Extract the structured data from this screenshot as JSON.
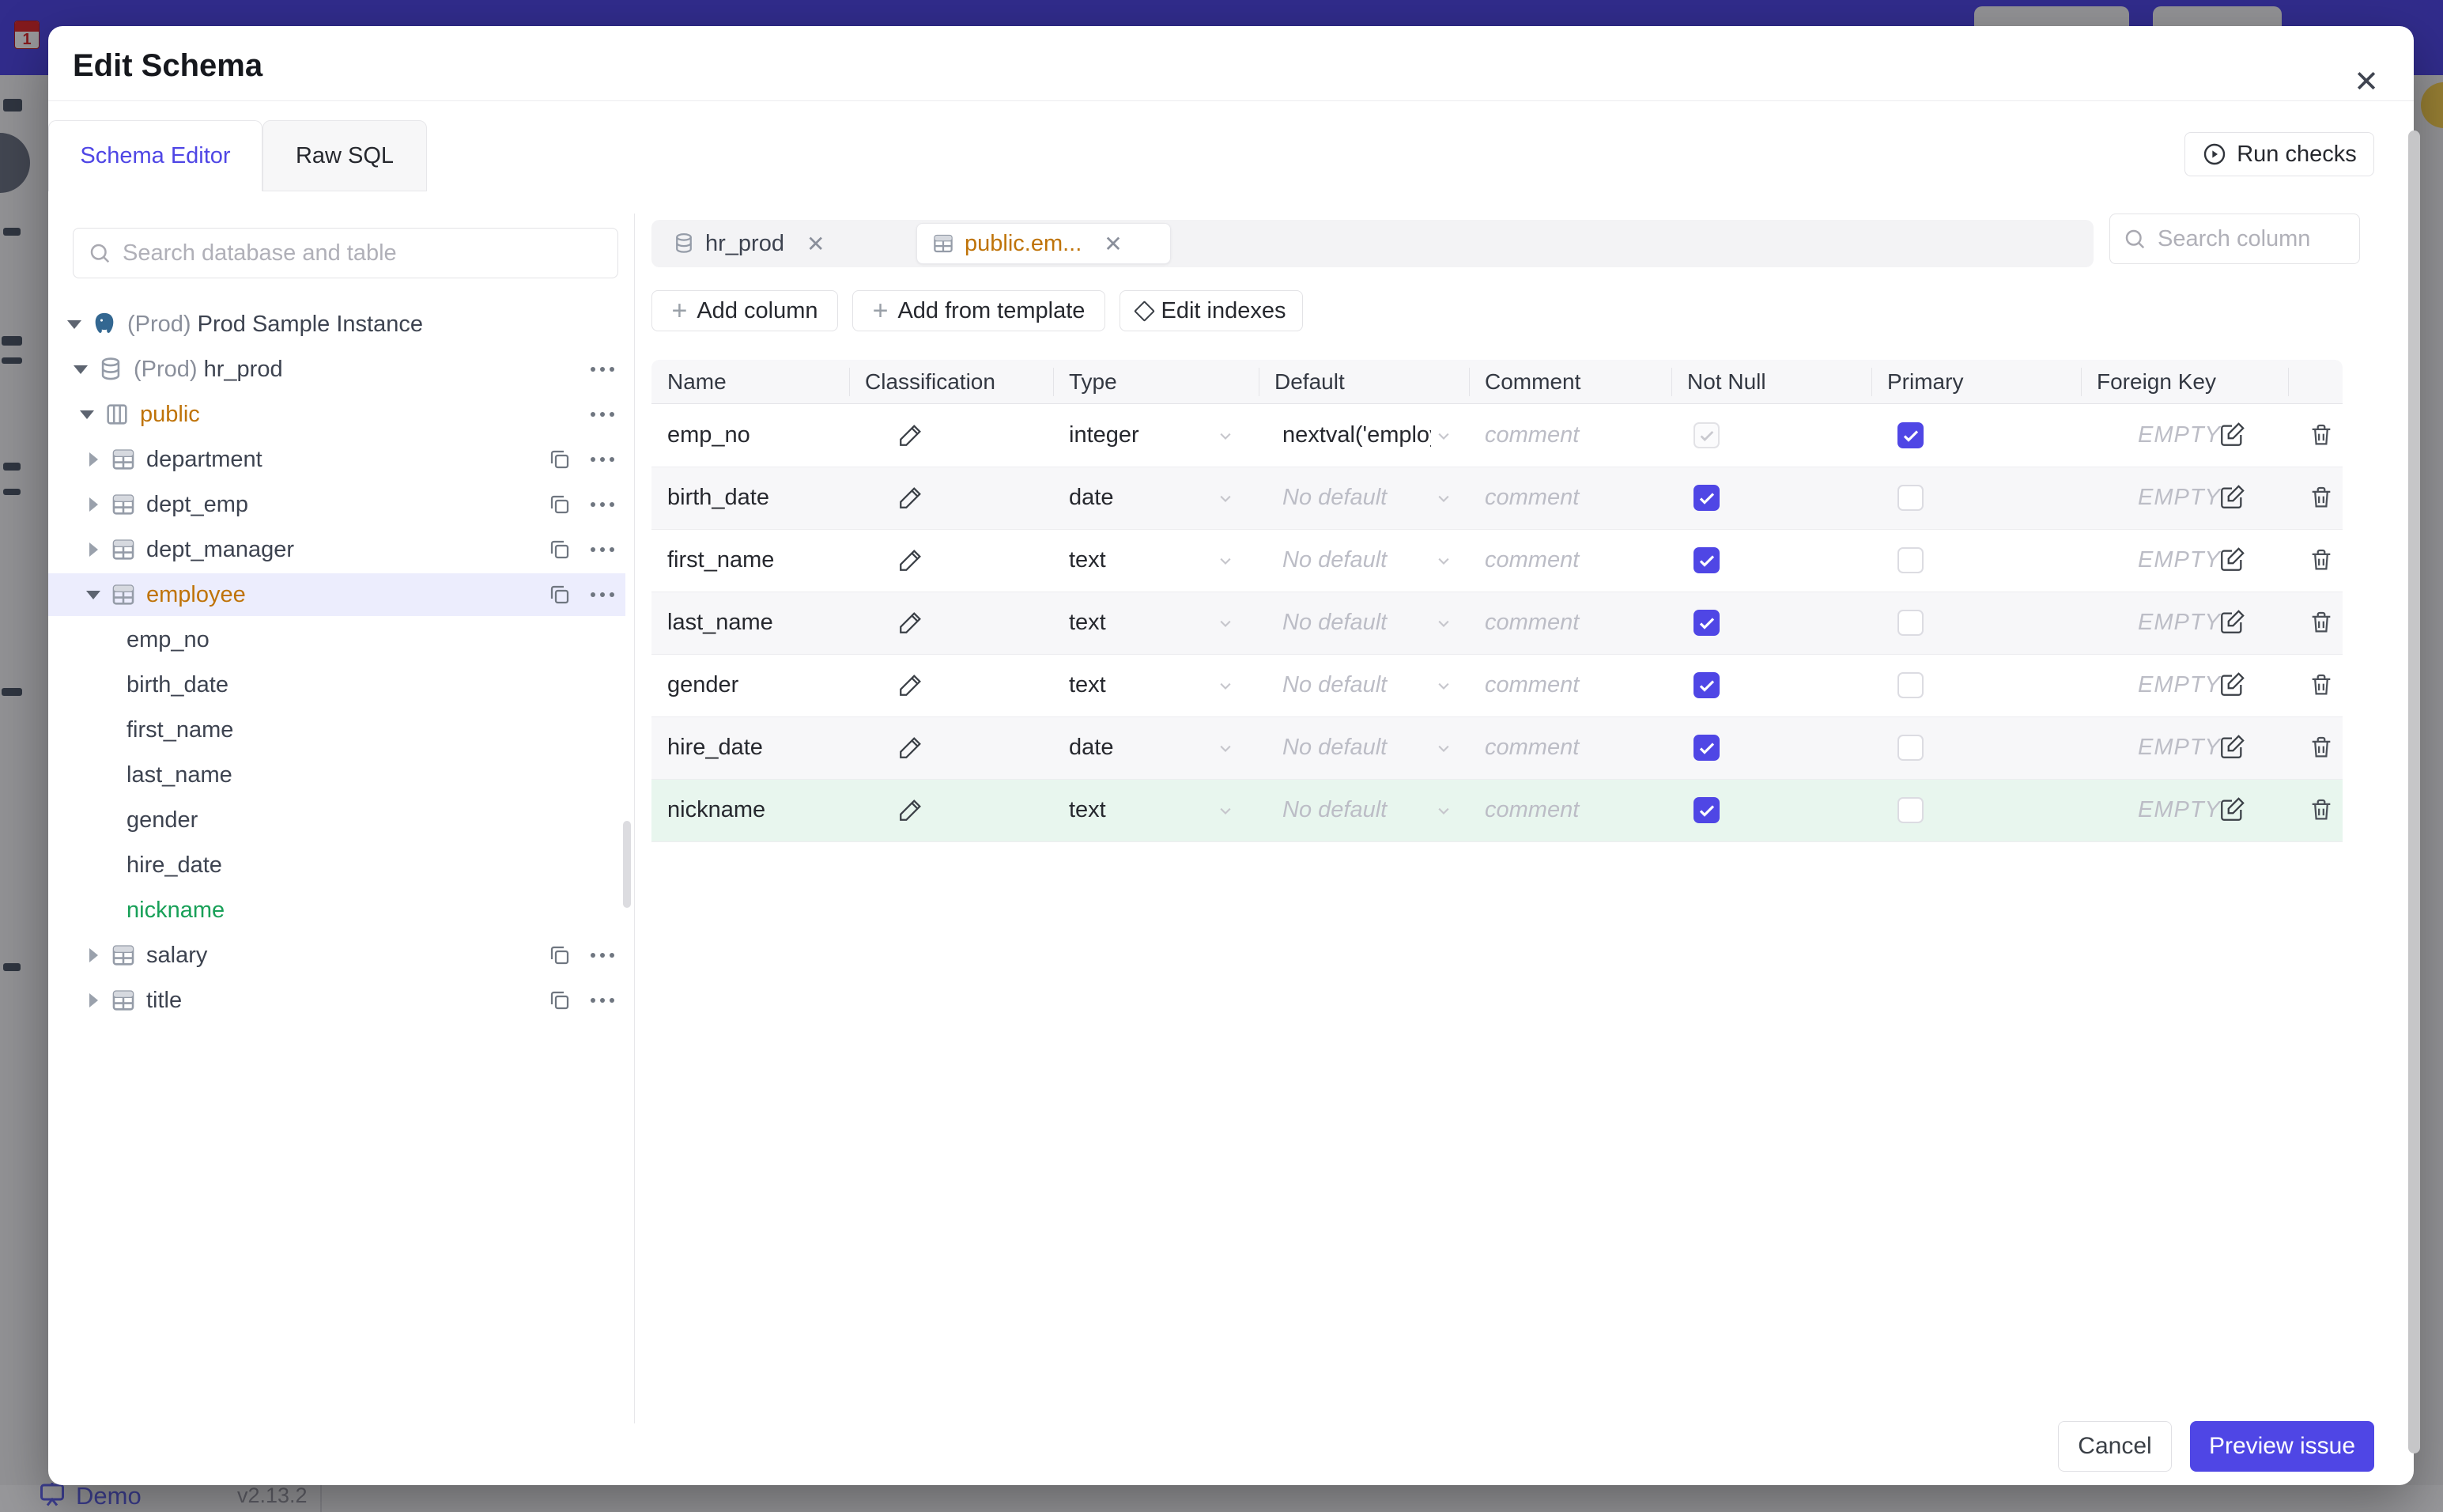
{
  "modal": {
    "title": "Edit Schema",
    "close_icon": "✕"
  },
  "tabs": {
    "schema_editor": "Schema Editor",
    "raw_sql": "Raw SQL"
  },
  "toolbar": {
    "run_checks": "Run checks"
  },
  "sidebar": {
    "search_placeholder": "Search database and table",
    "tree": [
      {
        "type": "instance",
        "prefix": "(Prod) ",
        "label": "Prod Sample Instance"
      },
      {
        "type": "database",
        "prefix": "(Prod) ",
        "label": "hr_prod"
      },
      {
        "type": "schema",
        "label": "public"
      },
      {
        "type": "table",
        "label": "department"
      },
      {
        "type": "table",
        "label": "dept_emp"
      },
      {
        "type": "table",
        "label": "dept_manager"
      },
      {
        "type": "table",
        "label": "employee",
        "state": "selected, expanded, modified"
      },
      {
        "type": "column",
        "label": "emp_no"
      },
      {
        "type": "column",
        "label": "birth_date"
      },
      {
        "type": "column",
        "label": "first_name"
      },
      {
        "type": "column",
        "label": "last_name"
      },
      {
        "type": "column",
        "label": "gender"
      },
      {
        "type": "column",
        "label": "hire_date"
      },
      {
        "type": "column",
        "label": "nickname",
        "state": "new"
      },
      {
        "type": "table",
        "label": "salary"
      },
      {
        "type": "table",
        "label": "title"
      }
    ]
  },
  "editor": {
    "open_tabs": [
      {
        "label": "hr_prod",
        "kind": "database",
        "active": false
      },
      {
        "label": "public.em...",
        "kind": "table",
        "active": true
      }
    ],
    "actions": {
      "add_column": "Add column",
      "add_from_template": "Add from template",
      "edit_indexes": "Edit indexes"
    },
    "search_placeholder": "Search column",
    "table": {
      "headers": [
        "Name",
        "Classification",
        "Type",
        "Default",
        "Comment",
        "Not Null",
        "Primary",
        "Foreign Key"
      ],
      "placeholders": {
        "comment": "comment",
        "no_default": "No default",
        "foreign_key": "EMPTY"
      },
      "rows": [
        {
          "name": "emp_no",
          "type": "integer",
          "default": "nextval('employ",
          "not_null": true,
          "not_null_disabled": true,
          "primary": true,
          "foreign_key": "EMPTY"
        },
        {
          "name": "birth_date",
          "type": "date",
          "default": "",
          "not_null": true,
          "primary": false,
          "foreign_key": "EMPTY"
        },
        {
          "name": "first_name",
          "type": "text",
          "default": "",
          "not_null": true,
          "primary": false,
          "foreign_key": "EMPTY"
        },
        {
          "name": "last_name",
          "type": "text",
          "default": "",
          "not_null": true,
          "primary": false,
          "foreign_key": "EMPTY"
        },
        {
          "name": "gender",
          "type": "text",
          "default": "",
          "not_null": true,
          "primary": false,
          "foreign_key": "EMPTY"
        },
        {
          "name": "hire_date",
          "type": "date",
          "default": "",
          "not_null": true,
          "primary": false,
          "foreign_key": "EMPTY"
        },
        {
          "name": "nickname",
          "type": "text",
          "default": "",
          "not_null": true,
          "primary": false,
          "foreign_key": "EMPTY",
          "state": "new"
        }
      ]
    }
  },
  "footer": {
    "cancel": "Cancel",
    "preview_issue": "Preview issue"
  },
  "backdrop": {
    "demo_label": "Demo",
    "version": "v2.13.2"
  },
  "colors": {
    "accent": "#4f46e5",
    "modified_amber": "#bf7308",
    "created_green": "#18a058",
    "header_indigo": "#4f46e5"
  }
}
